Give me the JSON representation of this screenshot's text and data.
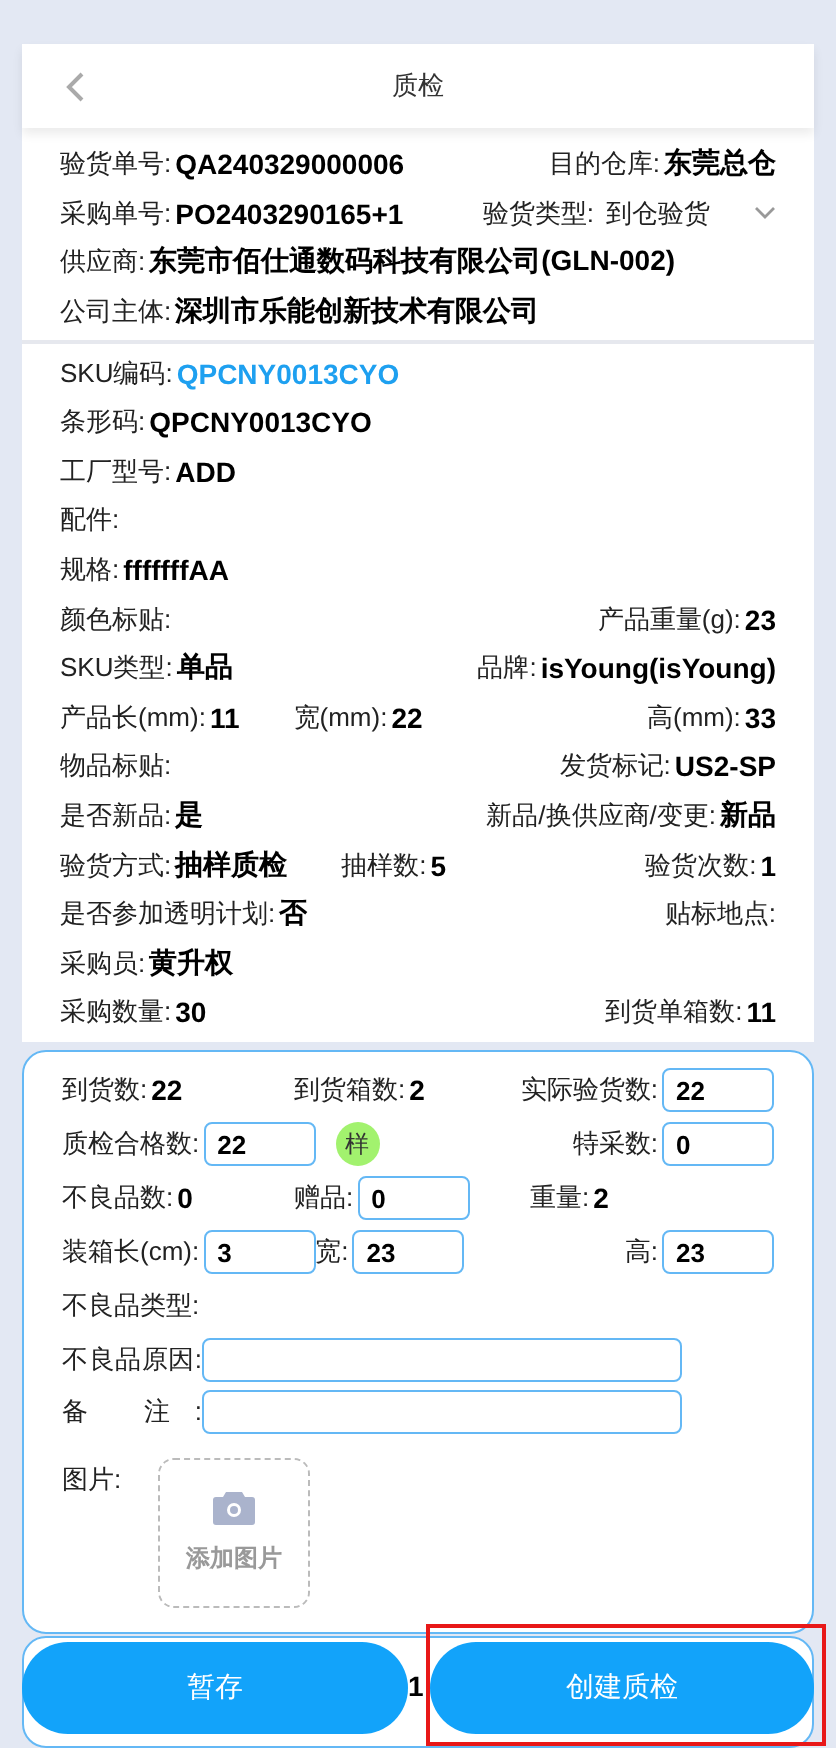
{
  "header": {
    "title": "质检"
  },
  "order_info": [
    [
      {
        "label": "验货单号:",
        "value": "QA240329000006",
        "kind": "text"
      },
      {
        "label": "目的仓库:",
        "value": "东莞总仓",
        "kind": "text"
      }
    ],
    [
      {
        "label": "采购单号:",
        "value": "PO2403290165+1",
        "kind": "text"
      },
      {
        "label": "验货类型:",
        "value": "到仓验货",
        "kind": "select"
      }
    ],
    [
      {
        "label": "供应商:",
        "value": "东莞市佰仕通数码科技有限公司(GLN-002)",
        "kind": "text"
      }
    ],
    [
      {
        "label": "公司主体:",
        "value": "深圳市乐能创新技术有限公司",
        "kind": "text"
      }
    ]
  ],
  "sku_info": [
    [
      {
        "label": "SKU编码:",
        "value": "QPCNY0013CYO",
        "kind": "link"
      }
    ],
    [
      {
        "label": "条形码:",
        "value": "QPCNY0013CYO",
        "kind": "text"
      }
    ],
    [
      {
        "label": "工厂型号:",
        "value": "ADD",
        "kind": "text"
      }
    ],
    [
      {
        "label": "配件:"
      }
    ],
    [
      {
        "label": "规格:",
        "value": "fffffffAA",
        "kind": "text"
      }
    ],
    [
      {
        "label": "颜色标贴:"
      },
      {
        "label": "产品重量(g):",
        "value": "23",
        "kind": "text"
      }
    ],
    [
      {
        "label": "SKU类型:",
        "value": "单品",
        "kind": "text"
      },
      {
        "label": "品牌:",
        "value": "isYoung(isYoung)",
        "kind": "text"
      }
    ],
    [
      {
        "label": "产品长(mm):",
        "value": "11",
        "kind": "text"
      },
      {
        "label": "宽(mm):",
        "value": "22",
        "kind": "text"
      },
      {
        "label": "高(mm):",
        "value": "33",
        "kind": "text"
      }
    ],
    [
      {
        "label": "物品标贴:"
      },
      {
        "label": "发货标记:",
        "value": "US2-SP",
        "kind": "text"
      }
    ],
    [
      {
        "label": "是否新品:",
        "value": "是",
        "kind": "text"
      },
      {
        "label": "新品/换供应商/变更:",
        "value": "新品",
        "kind": "text"
      }
    ],
    [
      {
        "label": "验货方式:",
        "value": "抽样质检",
        "kind": "text"
      },
      {
        "label": "抽样数:",
        "value": "5",
        "kind": "text"
      },
      {
        "label": "验货次数:",
        "value": "1",
        "kind": "text"
      }
    ],
    [
      {
        "label": "是否参加透明计划:",
        "value": "否",
        "kind": "text"
      },
      {
        "label": "贴标地点:"
      }
    ],
    [
      {
        "label": "采购员:",
        "value": "黄升权",
        "kind": "text"
      }
    ],
    [
      {
        "label": "采购数量:",
        "value": "30",
        "kind": "text"
      },
      {
        "label": "到货单箱数:",
        "value": "11",
        "kind": "text"
      }
    ]
  ],
  "quality_form": [
    [
      {
        "label": "到货数:",
        "value": "22",
        "kind": "static"
      },
      {
        "label": "到货箱数:",
        "value": "2",
        "kind": "static"
      },
      {
        "label": "实际验货数:",
        "value": "22",
        "kind": "input"
      }
    ],
    [
      {
        "label": "质检合格数:",
        "value": "22",
        "kind": "input"
      },
      {
        "label": "样",
        "kind": "badge"
      },
      {
        "label": "特采数:",
        "value": "0",
        "kind": "input"
      }
    ],
    [
      {
        "label": "不良品数:",
        "value": "0",
        "kind": "static"
      },
      {
        "label": "赠品:",
        "value": "0",
        "kind": "input"
      },
      {
        "label": "重量:",
        "value": "2",
        "kind": "static"
      }
    ],
    [
      {
        "label": "装箱长(cm):",
        "value": "3",
        "kind": "input"
      },
      {
        "label": "宽:",
        "value": "23",
        "kind": "input"
      },
      {
        "label": "高:",
        "value": "23",
        "kind": "input"
      }
    ],
    [
      {
        "label": "不良品类型:",
        "kind": "static"
      }
    ],
    [
      {
        "label": "不良品原因:",
        "kind": "wide"
      }
    ],
    [
      {
        "label": "备 注:",
        "kind": "wide"
      }
    ],
    [
      {
        "label": "图片:",
        "value": "添加图片",
        "kind": "upload"
      }
    ]
  ],
  "next_card": {
    "texts": [
      "1"
    ]
  },
  "actions": [
    {
      "label": "暂存",
      "highlighted": false
    },
    {
      "label": "创建质检",
      "highlighted": true
    }
  ]
}
